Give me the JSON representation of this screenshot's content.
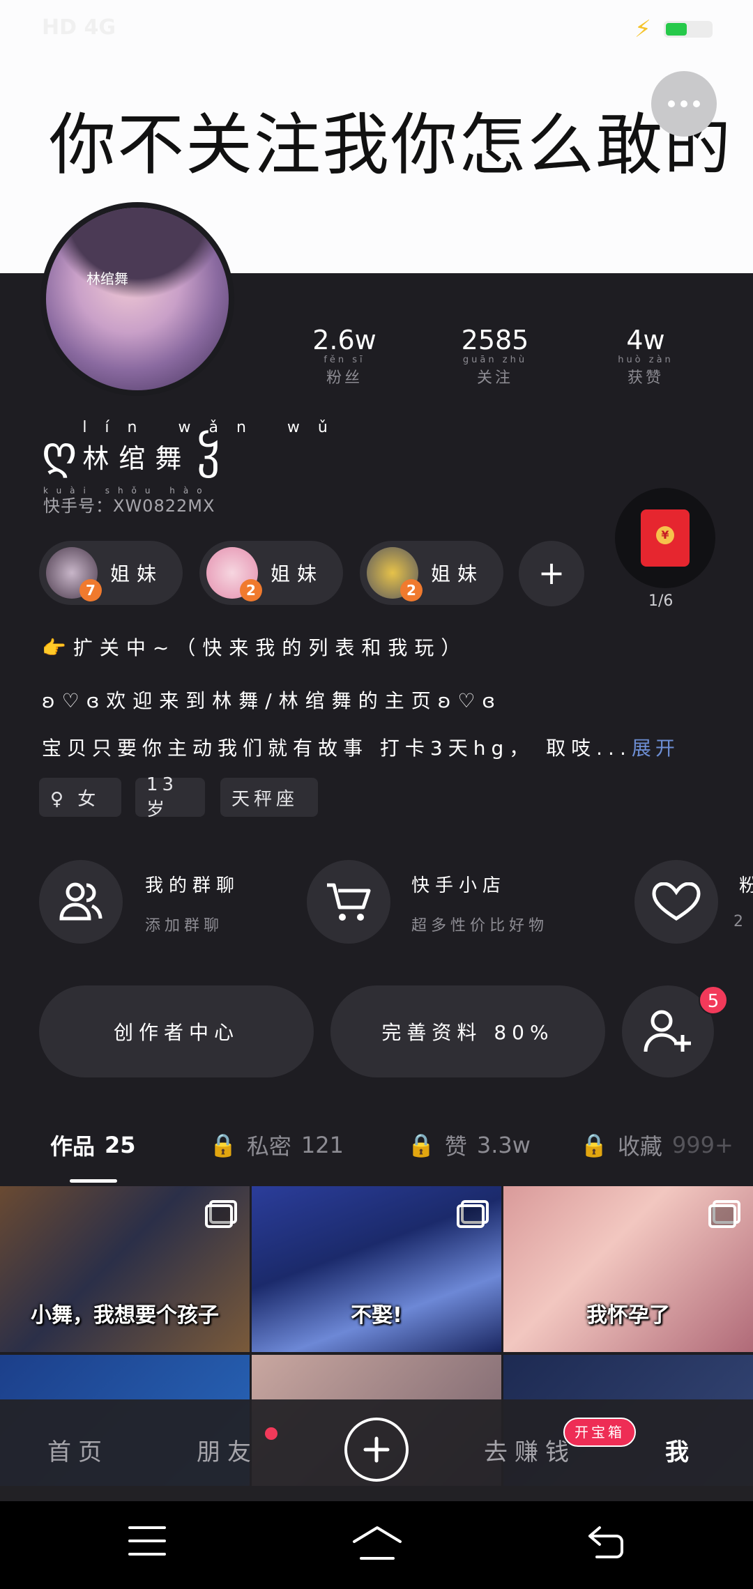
{
  "status_bar": {
    "carrier": "HD 4G",
    "battery_level": 0.6
  },
  "banner": {
    "text": "你不关注我你怎么敢的"
  },
  "stats": [
    {
      "value": "2.6w",
      "label": "粉丝",
      "pinyin": "fěn sī"
    },
    {
      "value": "2585",
      "label": "关注",
      "pinyin": "guān zhù"
    },
    {
      "value": "4w",
      "label": "获赞",
      "pinyin": "huò zàn"
    }
  ],
  "profile": {
    "avatar_tag": "林绾舞",
    "name": "林绾舞",
    "name_pinyin": "lín wǎn wǔ",
    "name_deco_left": "ღ",
    "name_deco_right": "ჴ",
    "kuaishou_id": "快手号：XW0822MX",
    "kuaishou_id_pinyin": "kuài shǒu hào"
  },
  "red_packet": {
    "count": "1/6"
  },
  "sister_chips": [
    {
      "label": "姐妹",
      "badge": "7"
    },
    {
      "label": "姐妹",
      "badge": "2"
    },
    {
      "label": "姐妹",
      "badge": "2"
    }
  ],
  "bio": {
    "line1": "👉扩关中~（快来我的列表和我玩）",
    "line2": "ʚ♡ɞ欢迎来到林舞/林绾舞的主页ʚ♡ɞ",
    "line3": "宝贝只要你主动我们就有故事 打卡3天hg， 取吱...",
    "expand": "展开"
  },
  "tags": [
    "♀ 女",
    "13岁",
    "天秤座"
  ],
  "services": [
    {
      "title": "我的群聊",
      "subtitle": "添加群聊"
    },
    {
      "title": "快手小店",
      "subtitle": "超多性价比好物"
    },
    {
      "title": "粉",
      "subtitle": "2"
    }
  ],
  "actions": {
    "creator_center": "创作者中心",
    "complete_profile": "完善资料 80%",
    "friend_notifications": "5"
  },
  "tabs": [
    {
      "label": "作品",
      "count": "25"
    },
    {
      "label": "私密",
      "count": "121"
    },
    {
      "label": "赞",
      "count": "3.3w"
    },
    {
      "label": "收藏",
      "count": "999+"
    }
  ],
  "grid": [
    {
      "caption": "小舞，我想要个孩子"
    },
    {
      "caption": "不娶!"
    },
    {
      "caption": "我怀孕了"
    }
  ],
  "bottom_nav": {
    "home": "首页",
    "friends": "朋友",
    "earn": "去赚钱",
    "earn_badge": "开宝箱",
    "me": "我"
  },
  "colors": {
    "accent": "#f23a5a",
    "bg": "#1e1d22",
    "chip": "#2f2e34",
    "link": "#6d8ed4"
  }
}
